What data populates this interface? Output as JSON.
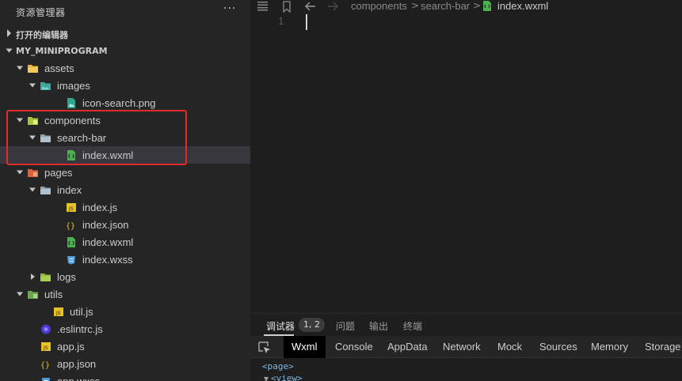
{
  "sidebar": {
    "title": "资源管理器",
    "more_label": "···",
    "open_editors_label": "打开的编辑器",
    "project_label": "MY_MINIPROGRAM",
    "tree": [
      {
        "name": "assets",
        "kind": "folder",
        "icon": "assets-folder-icon",
        "expanded": true
      },
      {
        "name": "images",
        "kind": "folder",
        "icon": "images-folder-icon",
        "expanded": true
      },
      {
        "name": "icon-search.png",
        "kind": "file",
        "icon": "image-file-icon"
      },
      {
        "name": "components",
        "kind": "folder",
        "icon": "components-folder-icon",
        "expanded": true
      },
      {
        "name": "search-bar",
        "kind": "folder",
        "icon": "folder-icon",
        "expanded": true
      },
      {
        "name": "index.wxml",
        "kind": "file",
        "icon": "wxml-file-icon",
        "selected": true
      },
      {
        "name": "pages",
        "kind": "folder",
        "icon": "pages-folder-icon",
        "expanded": true
      },
      {
        "name": "index",
        "kind": "folder",
        "icon": "folder-icon",
        "expanded": true
      },
      {
        "name": "index.js",
        "kind": "file",
        "icon": "js-file-icon"
      },
      {
        "name": "index.json",
        "kind": "file",
        "icon": "json-file-icon"
      },
      {
        "name": "index.wxml",
        "kind": "file",
        "icon": "wxml-file-icon"
      },
      {
        "name": "index.wxss",
        "kind": "file",
        "icon": "wxss-file-icon"
      },
      {
        "name": "logs",
        "kind": "folder",
        "icon": "logs-folder-icon",
        "expanded": false
      },
      {
        "name": "utils",
        "kind": "folder",
        "icon": "utils-folder-icon",
        "expanded": true
      },
      {
        "name": "util.js",
        "kind": "file",
        "icon": "js-file-icon"
      },
      {
        "name": ".eslintrc.js",
        "kind": "file",
        "icon": "eslint-file-icon"
      },
      {
        "name": "app.js",
        "kind": "file",
        "icon": "js-file-icon"
      },
      {
        "name": "app.json",
        "kind": "file",
        "icon": "json-file-icon"
      },
      {
        "name": "app.wxss",
        "kind": "file",
        "icon": "wxss-file-icon"
      }
    ]
  },
  "editor": {
    "breadcrumb": [
      "components",
      "search-bar",
      "index.wxml"
    ],
    "line_number": "1"
  },
  "debugger": {
    "panel_tabs": [
      "调试器",
      "问题",
      "输出",
      "终端"
    ],
    "badge": "1, 2",
    "devtools_tabs": [
      "Wxml",
      "Console",
      "AppData",
      "Network",
      "Mock",
      "Sources",
      "Memory",
      "Storage"
    ],
    "active_devtools_tab": "Wxml",
    "wxml_lines": [
      "<page>",
      "<view>"
    ]
  },
  "colors": {
    "highlight_box": "#e02b2b",
    "folder_yellow": "#e8b13a",
    "js_yellow": "#e6c229",
    "wxml_green": "#4caf50",
    "wxss_blue": "#4d9de0",
    "eslint_purple": "#4b3ccf"
  }
}
